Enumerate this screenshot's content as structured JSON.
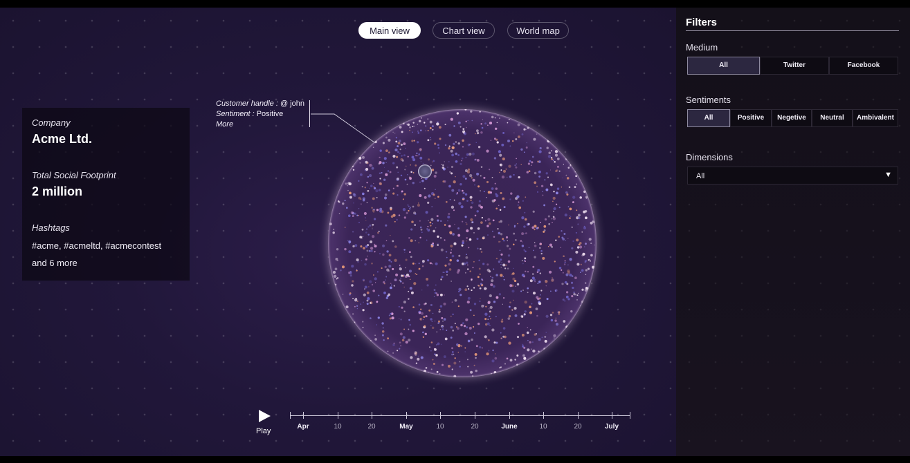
{
  "tabs": [
    {
      "label": "Main view",
      "active": true
    },
    {
      "label": "Chart view",
      "active": false
    },
    {
      "label": "World map",
      "active": false
    }
  ],
  "info": {
    "company_label": "Company",
    "company_value": "Acme Ltd.",
    "footprint_label": "Total Social Footprint",
    "footprint_value": "2 million",
    "hashtags_label": "Hashtags",
    "hashtags_value": "#acme, #acmeltd, #acmecontest",
    "hashtags_more": "and 6 more"
  },
  "tooltip": {
    "handle_label": "Customer handle :",
    "handle_value": "@ john",
    "sentiment_label": "Sentiment :",
    "sentiment_value": "Positive",
    "more": "More"
  },
  "timeline": {
    "play_label": "Play",
    "ticks": [
      {
        "label": "Apr",
        "month": true
      },
      {
        "label": "10",
        "month": false
      },
      {
        "label": "20",
        "month": false
      },
      {
        "label": "May",
        "month": true
      },
      {
        "label": "10",
        "month": false
      },
      {
        "label": "20",
        "month": false
      },
      {
        "label": "June",
        "month": true
      },
      {
        "label": "10",
        "month": false
      },
      {
        "label": "20",
        "month": false
      },
      {
        "label": "July",
        "month": true
      }
    ]
  },
  "filters": {
    "title": "Filters",
    "medium_label": "Medium",
    "medium_options": [
      "All",
      "Twitter",
      "Facebook"
    ],
    "medium_selected": "All",
    "sentiments_label": "Sentiments",
    "sentiment_options": [
      "All",
      "Positive",
      "Negetive",
      "Neutral",
      "Ambivalent"
    ],
    "sentiment_selected": "All",
    "dimensions_label": "Dimensions",
    "dimensions_value": "All"
  },
  "colors": {
    "background": "#21173a",
    "sidebar": "#16111d",
    "sphere_rim": "#f3e4f6",
    "particle_blue": "#8f86e8",
    "particle_orange": "#e89a78",
    "particle_pink": "#d79ad6"
  },
  "icons": {
    "play": "play-icon",
    "dropdown": "caret-down-icon"
  }
}
